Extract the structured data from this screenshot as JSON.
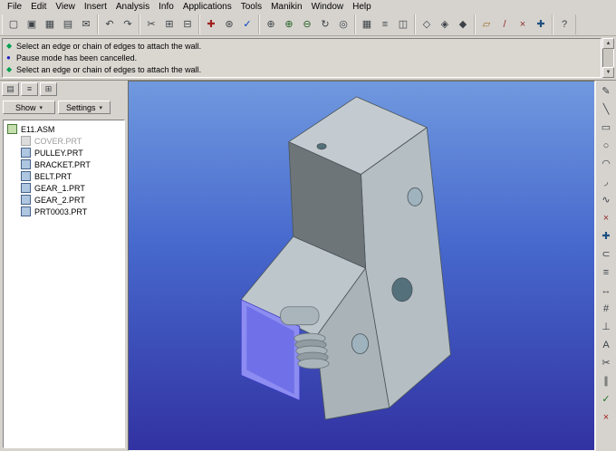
{
  "menu": {
    "items": [
      "File",
      "Edit",
      "View",
      "Insert",
      "Analysis",
      "Info",
      "Applications",
      "Tools",
      "Manikin",
      "Window",
      "Help"
    ]
  },
  "toolbar": {
    "groups": [
      [
        {
          "name": "new-file",
          "glyph": "▢"
        },
        {
          "name": "open-file",
          "glyph": "▣"
        },
        {
          "name": "save-file",
          "glyph": "▦"
        },
        {
          "name": "print",
          "glyph": "▤"
        },
        {
          "name": "email",
          "glyph": "✉"
        }
      ],
      [
        {
          "name": "undo",
          "glyph": "↶"
        },
        {
          "name": "redo",
          "glyph": "↷"
        }
      ],
      [
        {
          "name": "cut",
          "glyph": "✂"
        },
        {
          "name": "copy",
          "glyph": "⊞"
        },
        {
          "name": "paste",
          "glyph": "⊟"
        }
      ],
      [
        {
          "name": "regenerate",
          "glyph": "✚",
          "color": "#a02020"
        },
        {
          "name": "search",
          "glyph": "⊛"
        },
        {
          "name": "select-check",
          "glyph": "✓",
          "color": "#0040c0"
        }
      ],
      [
        {
          "name": "spin-center",
          "glyph": "⊕"
        },
        {
          "name": "zoom-in",
          "glyph": "⊕",
          "color": "#206020"
        },
        {
          "name": "zoom-out",
          "glyph": "⊖",
          "color": "#206020"
        },
        {
          "name": "refit",
          "glyph": "↻"
        },
        {
          "name": "repaint",
          "glyph": "◎"
        }
      ],
      [
        {
          "name": "saved-views",
          "glyph": "▦"
        },
        {
          "name": "layers",
          "glyph": "≡"
        },
        {
          "name": "view-manager",
          "glyph": "◫"
        }
      ],
      [
        {
          "name": "display-wireframe",
          "glyph": "◇"
        },
        {
          "name": "display-hidden-line",
          "glyph": "◈"
        },
        {
          "name": "display-shaded",
          "glyph": "◆"
        }
      ],
      [
        {
          "name": "datum-plane",
          "glyph": "▱",
          "color": "#9a6a20"
        },
        {
          "name": "datum-axis",
          "glyph": "/",
          "color": "#903030"
        },
        {
          "name": "datum-point",
          "glyph": "×",
          "color": "#903030"
        },
        {
          "name": "datum-csys",
          "glyph": "✚",
          "color": "#205080"
        }
      ],
      [
        {
          "name": "help",
          "glyph": "?"
        }
      ]
    ]
  },
  "messages": {
    "lines": [
      {
        "icon": "prompt-diamond-icon",
        "glyph": "◆",
        "color": "#00a050",
        "text": "Select an edge or chain of edges to attach the wall."
      },
      {
        "icon": "info-dot-icon",
        "glyph": "●",
        "color": "#2020c0",
        "text": "Pause mode has been cancelled."
      },
      {
        "icon": "prompt-diamond-icon",
        "glyph": "◆",
        "color": "#00a050",
        "text": "Select an edge or chain of edges to attach the wall."
      }
    ]
  },
  "left_panel": {
    "mini_toolbar": [
      {
        "name": "model-tree-toggle",
        "glyph": "▤"
      },
      {
        "name": "layer-tree-toggle",
        "glyph": "≡"
      },
      {
        "name": "folder-browser",
        "glyph": "⊞"
      }
    ],
    "show_label": "Show",
    "settings_label": "Settings"
  },
  "tree": {
    "root": "E11.ASM",
    "items": [
      {
        "label": "COVER.PRT",
        "dim": true
      },
      {
        "label": "PULLEY.PRT",
        "dim": false
      },
      {
        "label": "BRACKET.PRT",
        "dim": false
      },
      {
        "label": "BELT.PRT",
        "dim": false
      },
      {
        "label": "GEAR_1.PRT",
        "dim": false
      },
      {
        "label": "GEAR_2.PRT",
        "dim": false
      },
      {
        "label": "PRT0003.PRT",
        "dim": false
      }
    ]
  },
  "viewport": {
    "bg_top": "#7099df",
    "bg_mid": "#4668cd",
    "bg_bottom": "#3232a2"
  },
  "model": {
    "top_face_color": "#c3cbd0",
    "dark_face_color": "#6d7579",
    "right_face_color": "#b4bec3",
    "slant_face_color": "#bdc6cb",
    "front_face_color": "#a9b3b8",
    "hole_dark_color": "#53707b",
    "hole_light_color": "#9fb3bf",
    "selected_wall_color": "#8c8cf2",
    "selected_wall_inner_color": "#7070e8",
    "gear_color": "#a9b5ba",
    "gear_dark_color": "#909ca1"
  },
  "right_toolbar": {
    "icons": [
      {
        "name": "sketch-tool",
        "glyph": "✎"
      },
      {
        "name": "line-tool",
        "glyph": "╲"
      },
      {
        "name": "rectangle-tool",
        "glyph": "▭"
      },
      {
        "name": "circle-tool",
        "glyph": "○"
      },
      {
        "name": "arc-tool",
        "glyph": "◠"
      },
      {
        "name": "fillet-tool",
        "glyph": "◞"
      },
      {
        "name": "spline-tool",
        "glyph": "∿"
      },
      {
        "name": "point-tool",
        "glyph": "×",
        "color": "#903030"
      },
      {
        "name": "csys-tool",
        "glyph": "✚",
        "color": "#205080"
      },
      {
        "name": "use-edge-tool",
        "glyph": "⊂"
      },
      {
        "name": "offset-edge-tool",
        "glyph": "≡"
      },
      {
        "name": "dimension-tool",
        "glyph": "↔"
      },
      {
        "name": "modify-tool",
        "glyph": "#"
      },
      {
        "name": "constraint-tool",
        "glyph": "⊥"
      },
      {
        "name": "text-tool",
        "glyph": "A"
      },
      {
        "name": "trim-tool",
        "glyph": "✂"
      },
      {
        "name": "mirror-tool",
        "glyph": "∥"
      },
      {
        "name": "done-tool",
        "glyph": "✓",
        "color": "#207020"
      },
      {
        "name": "quit-tool",
        "glyph": "×",
        "color": "#a02020"
      }
    ]
  }
}
